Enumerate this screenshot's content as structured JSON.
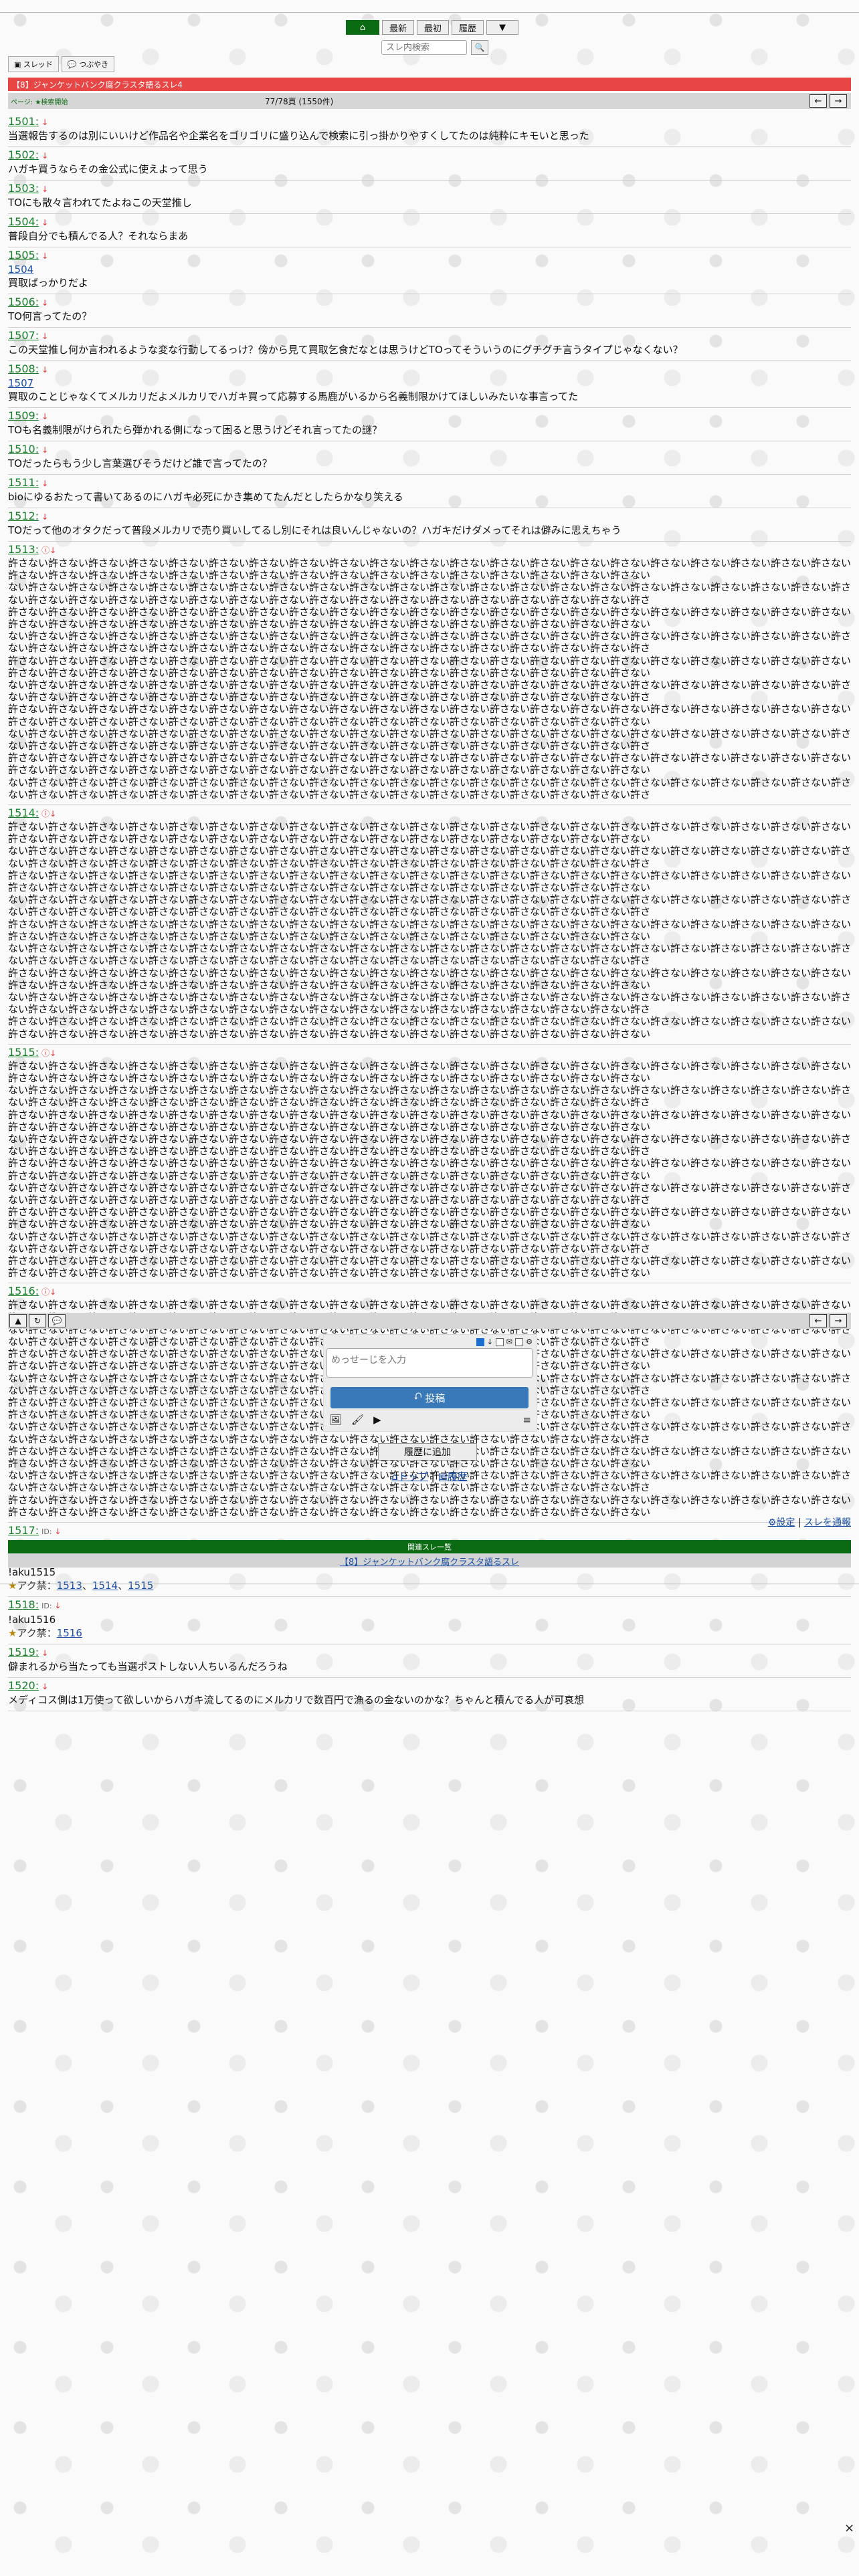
{
  "nav": {
    "home_icon": "home-icon",
    "latest": "最新",
    "first": "最初",
    "history": "履歴",
    "dropdown": "▼"
  },
  "search": {
    "placeholder": "スレ内検索"
  },
  "tabs": [
    {
      "label": "スレッド"
    },
    {
      "label": "つぶやき"
    }
  ],
  "thread": {
    "title": "【8】ジャンケットバンク腐クラスタ語るスレ4",
    "info_left": "ページ: ★検索開始",
    "info_page": "77/78頁 (1550件)"
  },
  "posts": [
    {
      "num": "1501:",
      "marker": "↓",
      "lines": [
        "当選報告するのは別にいいけど作品名や企業名をゴリゴリに盛り込んで検索に引っ掛かりやすくしてたのは純粋にキモいと思った"
      ]
    },
    {
      "num": "1502:",
      "marker": "↓",
      "lines": [
        "ハガキ買うならその金公式に使えよって思う"
      ]
    },
    {
      "num": "1503:",
      "marker": "↓",
      "lines": [
        "TOにも散々言われてたよねこの天堂推し"
      ]
    },
    {
      "num": "1504:",
      "marker": "↓",
      "lines": [
        "普段自分でも積んでる人？それならまあ"
      ]
    },
    {
      "num": "1505:",
      "marker": "↓",
      "reply": "1504",
      "lines": [
        "買取ばっかりだよ"
      ]
    },
    {
      "num": "1506:",
      "marker": "↓",
      "lines": [
        "TO何言ってたの？"
      ]
    },
    {
      "num": "1507:",
      "marker": "↓",
      "lines": [
        "この天堂推し何か言われるような変な行動してるっけ？傍から見て買取乞食だなとは思うけどTOってそういうのにグチグチ言うタイプじゃなくない？"
      ]
    },
    {
      "num": "1508:",
      "marker": "↓",
      "reply": "1507",
      "lines": [
        "買取のことじゃなくてメルカリだよメルカリでハガキ買って応募する馬鹿がいるから名義制限かけてほしいみたいな事言ってた"
      ]
    },
    {
      "num": "1509:",
      "marker": "↓",
      "lines": [
        "TOも名義制限がけられたら弾かれる側になって困ると思うけどそれ言ってたの謎？"
      ]
    },
    {
      "num": "1510:",
      "marker": "↓",
      "lines": [
        "TOだったらもう少し言葉選びそうだけど誰で言ってたの？"
      ]
    },
    {
      "num": "1511:",
      "marker": "↓",
      "lines": [
        "bioにゆるおたって書いてあるのにハガキ必死にかき集めてたんだとしたらかなり笑える"
      ]
    },
    {
      "num": "1512:",
      "marker": "↓",
      "lines": [
        "TOだって他のオタクだって普段メルカリで売り買いしてるし別にそれは良いんじゃないの？ハガキだけダメってそれは僻みに思えちゃう"
      ]
    },
    {
      "num": "1513:",
      "marker": "ⓘ↓",
      "multi": true,
      "lines": [
        "許さない許さない許さない許さない許さない許さない許さない許さない許さない許さない許さない許さない許さない許さない許さない許さない許さない許さない許さない許さない許さない許さない許さない許さない許さない許さない許さない許さない許さない許さない許さない許さない許さない許さない許さない許さない許さない",
        "ない許さない許さない許さない許さない許さない許さない許さない許さない許さない許さない許さない許さない許さない許さない許さない許さない許さない許さない許さない許さない許さない許さない許さない許さない許さない許さない許さない許さない許さない許さない許さない許さない許さない許さない許さない許さない許さ",
        "許さない許さない許さない許さない許さない許さない許さない許さない許さない許さない許さない許さない許さない許さない許さない許さない許さない許さない許さない許さない許さない許さない許さない許さない許さない許さない許さない許さない許さない許さない許さない許さない許さない許さない許さない許さない許さない",
        "ない許さない許さない許さない許さない許さない許さない許さない許さない許さない許さない許さない許さない許さない許さない許さない許さない許さない許さない許さない許さない許さない許さない許さない許さない許さない許さない許さない許さない許さない許さない許さない許さない許さない許さない許さない許さない許さ",
        "許さない許さない許さない許さない許さない許さない許さない許さない許さない許さない許さない許さない許さない許さない許さない許さない許さない許さない許さない許さない許さない許さない許さない許さない許さない許さない許さない許さない許さない許さない許さない許さない許さない許さない許さない許さない許さない",
        "ない許さない許さない許さない許さない許さない許さない許さない許さない許さない許さない許さない許さない許さない許さない許さない許さない許さない許さない許さない許さない許さない許さない許さない許さない許さない許さない許さない許さない許さない許さない許さない許さない許さない許さない許さない許さない許さ",
        "許さない許さない許さない許さない許さない許さない許さない許さない許さない許さない許さない許さない許さない許さない許さない許さない許さない許さない許さない許さない許さない許さない許さない許さない許さない許さない許さない許さない許さない許さない許さない許さない許さない許さない許さない許さない許さない",
        "ない許さない許さない許さない許さない許さない許さない許さない許さない許さない許さない許さない許さない許さない許さない許さない許さない許さない許さない許さない許さない許さない許さない許さない許さない許さない許さない許さない許さない許さない許さない許さない許さない許さない許さない許さない許さない許さ",
        "許さない許さない許さない許さない許さない許さない許さない許さない許さない許さない許さない許さない許さない許さない許さない許さない許さない許さない許さない許さない許さない許さない許さない許さない許さない許さない許さない許さない許さない許さない許さない許さない許さない許さない許さない許さない許さない",
        "ない許さない許さない許さない許さない許さない許さない許さない許さない許さない許さない許さない許さない許さない許さない許さない許さない許さない許さない許さない許さない許さない許さない許さない許さない許さない許さない許さない許さない許さない許さない許さない許さない許さない許さない許さない許さない許さ"
      ]
    },
    {
      "num": "1514:",
      "marker": "ⓘ↓",
      "multi": true,
      "lines": [
        "許さない許さない許さない許さない許さない許さない許さない許さない許さない許さない許さない許さない許さない許さない許さない許さない許さない許さない許さない許さない許さない許さない許さない許さない許さない許さない許さない許さない許さない許さない許さない許さない許さない許さない許さない許さない許さない",
        "ない許さない許さない許さない許さない許さない許さない許さない許さない許さない許さない許さない許さない許さない許さない許さない許さない許さない許さない許さない許さない許さない許さない許さない許さない許さない許さない許さない許さない許さない許さない許さない許さない許さない許さない許さない許さない許さ",
        "許さない許さない許さない許さない許さない許さない許さない許さない許さない許さない許さない許さない許さない許さない許さない許さない許さない許さない許さない許さない許さない許さない許さない許さない許さない許さない許さない許さない許さない許さない許さない許さない許さない許さない許さない許さない許さない",
        "ない許さない許さない許さない許さない許さない許さない許さない許さない許さない許さない許さない許さない許さない許さない許さない許さない許さない許さない許さない許さない許さない許さない許さない許さない許さない許さない許さない許さない許さない許さない許さない許さない許さない許さない許さない許さない許さ",
        "許さない許さない許さない許さない許さない許さない許さない許さない許さない許さない許さない許さない許さない許さない許さない許さない許さない許さない許さない許さない許さない許さない許さない許さない許さない許さない許さない許さない許さない許さない許さない許さない許さない許さない許さない許さない許さない",
        "ない許さない許さない許さない許さない許さない許さない許さない許さない許さない許さない許さない許さない許さない許さない許さない許さない許さない許さない許さない許さない許さない許さない許さない許さない許さない許さない許さない許さない許さない許さない許さない許さない許さない許さない許さない許さない許さ",
        "許さない許さない許さない許さない許さない許さない許さない許さない許さない許さない許さない許さない許さない許さない許さない許さない許さない許さない許さない許さない許さない許さない許さない許さない許さない許さない許さない許さない許さない許さない許さない許さない許さない許さない許さない許さない許さない",
        "ない許さない許さない許さない許さない許さない許さない許さない許さない許さない許さない許さない許さない許さない許さない許さない許さない許さない許さない許さない許さない許さない許さない許さない許さない許さない許さない許さない許さない許さない許さない許さない許さない許さない許さない許さない許さない許さ",
        "許さない許さない許さない許さない許さない許さない許さない許さない許さない許さない許さない許さない許さない許さない許さない許さない許さない許さない許さない許さない許さない許さない許さない許さない許さない許さない許さない許さない許さない許さない許さない許さない許さない許さない許さない許さない許さない"
      ]
    },
    {
      "num": "1515:",
      "marker": "ⓘ↓",
      "multi": true,
      "lines": [
        "許さない許さない許さない許さない許さない許さない許さない許さない許さない許さない許さない許さない許さない許さない許さない許さない許さない許さない許さない許さない許さない許さない許さない許さない許さない許さない許さない許さない許さない許さない許さない許さない許さない許さない許さない許さない許さない",
        "ない許さない許さない許さない許さない許さない許さない許さない許さない許さない許さない許さない許さない許さない許さない許さない許さない許さない許さない許さない許さない許さない許さない許さない許さない許さない許さない許さない許さない許さない許さない許さない許さない許さない許さない許さない許さない許さ",
        "許さない許さない許さない許さない許さない許さない許さない許さない許さない許さない許さない許さない許さない許さない許さない許さない許さない許さない許さない許さない許さない許さない許さない許さない許さない許さない許さない許さない許さない許さない許さない許さない許さない許さない許さない許さない許さない",
        "ない許さない許さない許さない許さない許さない許さない許さない許さない許さない許さない許さない許さない許さない許さない許さない許さない許さない許さない許さない許さない許さない許さない許さない許さない許さない許さない許さない許さない許さない許さない許さない許さない許さない許さない許さない許さない許さ",
        "許さない許さない許さない許さない許さない許さない許さない許さない許さない許さない許さない許さない許さない許さない許さない許さない許さない許さない許さない許さない許さない許さない許さない許さない許さない許さない許さない許さない許さない許さない許さない許さない許さない許さない許さない許さない許さない",
        "ない許さない許さない許さない許さない許さない許さない許さない許さない許さない許さない許さない許さない許さない許さない許さない許さない許さない許さない許さない許さない許さない許さない許さない許さない許さない許さない許さない許さない許さない許さない許さない許さない許さない許さない許さない許さない許さ",
        "許さない許さない許さない許さない許さない許さない許さない許さない許さない許さない許さない許さない許さない許さない許さない許さない許さない許さない許さない許さない許さない許さない許さない許さない許さない許さない許さない許さない許さない許さない許さない許さない許さない許さない許さない許さない許さない",
        "ない許さない許さない許さない許さない許さない許さない許さない許さない許さない許さない許さない許さない許さない許さない許さない許さない許さない許さない許さない許さない許さない許さない許さない許さない許さない許さない許さない許さない許さない許さない許さない許さない許さない許さない許さない許さない許さ",
        "許さない許さない許さない許さない許さない許さない許さない許さない許さない許さない許さない許さない許さない許さない許さない許さない許さない許さない許さない許さない許さない許さない許さない許さない許さない許さない許さない許さない許さない許さない許さない許さない許さない許さない許さない許さない許さない"
      ]
    },
    {
      "num": "1516:",
      "marker": "ⓘ↓",
      "multi": true,
      "lines": [
        "許さない許さない許さない許さない許さない許さない許さない許さない許さない許さない許さない許さない許さない許さない許さない許さない許さない許さない許さない許さない許さない許さない許さない許さない許さない許さない許さない許さない許さない許さない許さない許さない許さない許さない許さない許さない許さない",
        "ない許さない許さない許さない許さない許さない許さない許さない許さない許さない許さない許さない許さない許さない許さない許さない許さない許さない許さない許さない許さない許さない許さない許さない許さない許さない許さない許さない許さない許さない許さない許さない許さない許さない許さない許さない許さない許さ",
        "許さない許さない許さない許さない許さない許さない許さない許さない許さない許さない許さない許さない許さない許さない許さない許さない許さない許さない許さない許さない許さない許さない許さない許さない許さない許さない許さない許さない許さない許さない許さない許さない許さない許さない許さない許さない許さない",
        "ない許さない許さない許さない許さない許さない許さない許さない許さない許さない許さない許さない許さない許さない許さない許さない許さない許さない許さない許さない許さない許さない許さない許さない許さない許さない許さない許さない許さない許さない許さない許さない許さない許さない許さない許さない許さない許さ",
        "許さない許さない許さない許さない許さない許さない許さない許さない許さない許さない許さない許さない許さない許さない許さない許さない許さない許さない許さない許さない許さない許さない許さない許さない許さない許さない許さない許さない許さない許さない許さない許さない許さない許さない許さない許さない許さない",
        "ない許さない許さない許さない許さない許さない許さない許さない許さない許さない許さない許さない許さない許さない許さない許さない許さない許さない許さない許さない許さない許さない許さない許さない許さない許さない許さない許さない許さない許さない許さない許さない許さない許さない許さない許さない許さない許さ",
        "許さない許さない許さない許さない許さない許さない許さない許さない許さない許さない許さない許さない許さない許さない許さない許さない許さない許さない許さない許さない許さない許さない許さない許さない許さない許さない許さない許さない許さない許さない許さない許さない許さない許さない許さない許さない許さない",
        "ない許さない許さない許さない許さない許さない許さない許さない許さない許さない許さない許さない許さない許さない許さない許さない許さない許さない許さない許さない許さない許さない許さない許さない許さない許さない許さない許さない許さない許さない許さない許さない許さない許さない許さない許さない許さない許さ",
        "許さない許さない許さない許さない許さない許さない許さない許さない許さない許さない許さない許さない許さない許さない許さない許さない許さない許さない許さない許さない許さない許さない許さない許さない許さない許さない許さない許さない許さない許さない許さない許さない許さない許さない許さない許さない許さない"
      ]
    },
    {
      "num": "1517:",
      "marker": "↓",
      "id": "ID:",
      "lines": [
        "!aku1513",
        "!aku1514",
        "!aku1515"
      ],
      "aku": {
        "label": "アク禁：",
        "links": [
          "1513",
          "1514",
          "1515"
        ]
      }
    },
    {
      "num": "1518:",
      "marker": "↓",
      "id": "ID:",
      "lines": [
        "!aku1516"
      ],
      "aku": {
        "label": "アク禁：",
        "links": [
          "1516"
        ]
      }
    },
    {
      "num": "1519:",
      "marker": "↓",
      "lines": [
        "僻まれるから当たっても当選ポストしない人ちいるんだろうね"
      ]
    },
    {
      "num": "1520:",
      "marker": "↓",
      "lines": [
        "メディコス側は1万使って欲しいからハガキ流してるのにメルカリで数百円で漁るの金ないのかな？ちゃんと積んでる人が可哀想"
      ]
    }
  ],
  "form": {
    "placeholder": "めっせーじを入力",
    "post_label": "投稿",
    "opts": [
      "↓",
      "✉",
      "⚙"
    ]
  },
  "history_button": "履歴に追加",
  "bottom_links": {
    "top": "トップ",
    "sep": "|",
    "history": "履歴"
  },
  "right_links": {
    "settings": "設定",
    "sep": "|",
    "report": "スレを通報"
  },
  "related": {
    "header": "関連スレ一覧",
    "item": "【8】ジャンケットバンク腐クラスタ語るスレ"
  },
  "close": "×"
}
